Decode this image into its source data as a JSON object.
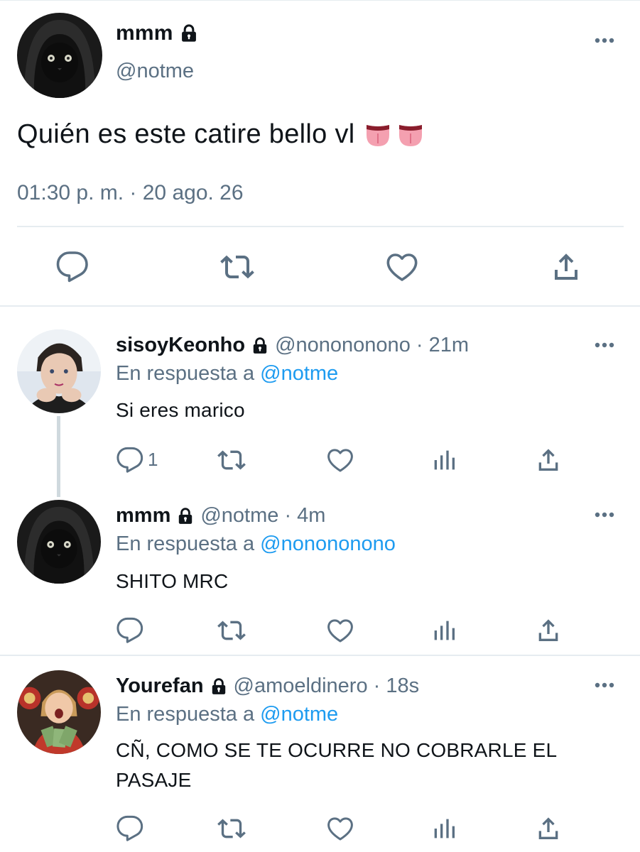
{
  "main_tweet": {
    "display_name": "mmm",
    "handle": "@notme",
    "text": "Quién es este catire bello vl",
    "timestamp": "01:30 p. m. · 20 ago. 26",
    "text_emojis": [
      "tongue-emoji",
      "tongue-emoji"
    ]
  },
  "replies": [
    {
      "display_name": "sisoyKeonho",
      "handle_time": "@nonononono · 21m",
      "in_reply_prefix": "En respuesta a",
      "in_reply_to": "@notme",
      "text": "Si eres marico",
      "reply_count": "1"
    },
    {
      "display_name": "mmm",
      "handle_time": "@notme · 4m",
      "in_reply_prefix": "En respuesta a",
      "in_reply_to": "@nonononono",
      "text": "SHITO MRC"
    },
    {
      "display_name": "Yourefan",
      "handle_time": "@amoeldinero · 18s",
      "in_reply_prefix": "En respuesta a",
      "in_reply_to": "@notme",
      "text": "CÑ, COMO SE TE OCURRE NO COBRARLE EL PASAJE"
    }
  ],
  "colors": {
    "text": "#0f1419",
    "secondary": "#5b7083",
    "link": "#1d9bf0",
    "divider": "#e6ecf0"
  },
  "icons": [
    "lock-icon",
    "more-icon",
    "reply-icon",
    "retweet-icon",
    "like-icon",
    "analytics-icon",
    "share-icon"
  ]
}
